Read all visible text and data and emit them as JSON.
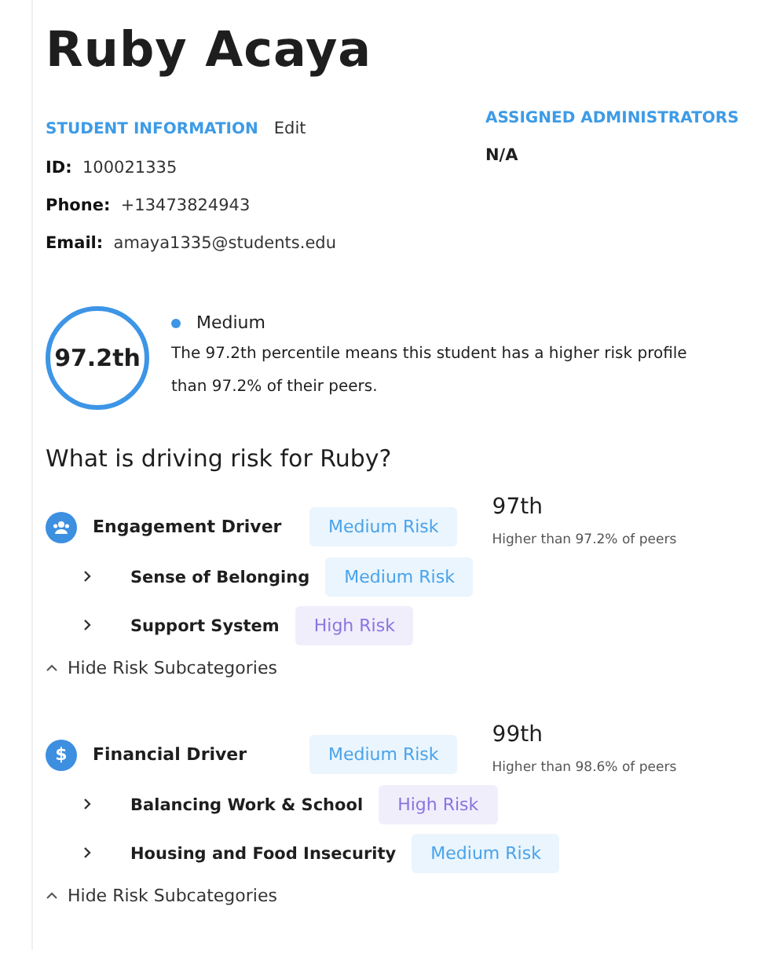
{
  "student": {
    "name": "Ruby Acaya"
  },
  "info": {
    "heading": "STUDENT INFORMATION",
    "edit": "Edit",
    "fields": [
      {
        "label": "ID:",
        "value": "100021335"
      },
      {
        "label": "Phone:",
        "value": "+13473824943"
      },
      {
        "label": "Email:",
        "value": "amaya1335@students.edu"
      }
    ]
  },
  "administrators": {
    "heading": "ASSIGNED ADMINISTRATORS",
    "value": "N/A"
  },
  "overall": {
    "percentile": "97.2th",
    "level": "Medium",
    "color": "#3d95e6",
    "description": "The 97.2th percentile means this student has a higher risk profile than 97.2% of their peers."
  },
  "drivers_heading": "What is driving risk for Ruby?",
  "drivers": [
    {
      "name": "Engagement Driver",
      "icon": {
        "kind": "people"
      },
      "risk": {
        "kind": "medium",
        "label": "Medium Risk"
      },
      "percentile": "97th",
      "comparison": "Higher than 97.2% of peers",
      "expanded": true,
      "toggle": "Hide Risk Subcategories",
      "subcategories": [
        {
          "name": "Sense of Belonging",
          "risk": {
            "kind": "medium",
            "label": "Medium Risk"
          }
        },
        {
          "name": "Support System",
          "risk": {
            "kind": "high",
            "label": "High Risk"
          }
        }
      ]
    },
    {
      "name": "Financial Driver",
      "icon": {
        "kind": "glyph",
        "text": "$"
      },
      "risk": {
        "kind": "medium",
        "label": "Medium Risk"
      },
      "percentile": "99th",
      "comparison": "Higher than 98.6% of peers",
      "expanded": true,
      "toggle": "Hide Risk Subcategories",
      "subcategories": [
        {
          "name": "Balancing Work & School",
          "risk": {
            "kind": "high",
            "label": "High Risk"
          }
        },
        {
          "name": "Housing and Food Insecurity",
          "risk": {
            "kind": "medium",
            "label": "Medium Risk"
          }
        }
      ]
    }
  ]
}
